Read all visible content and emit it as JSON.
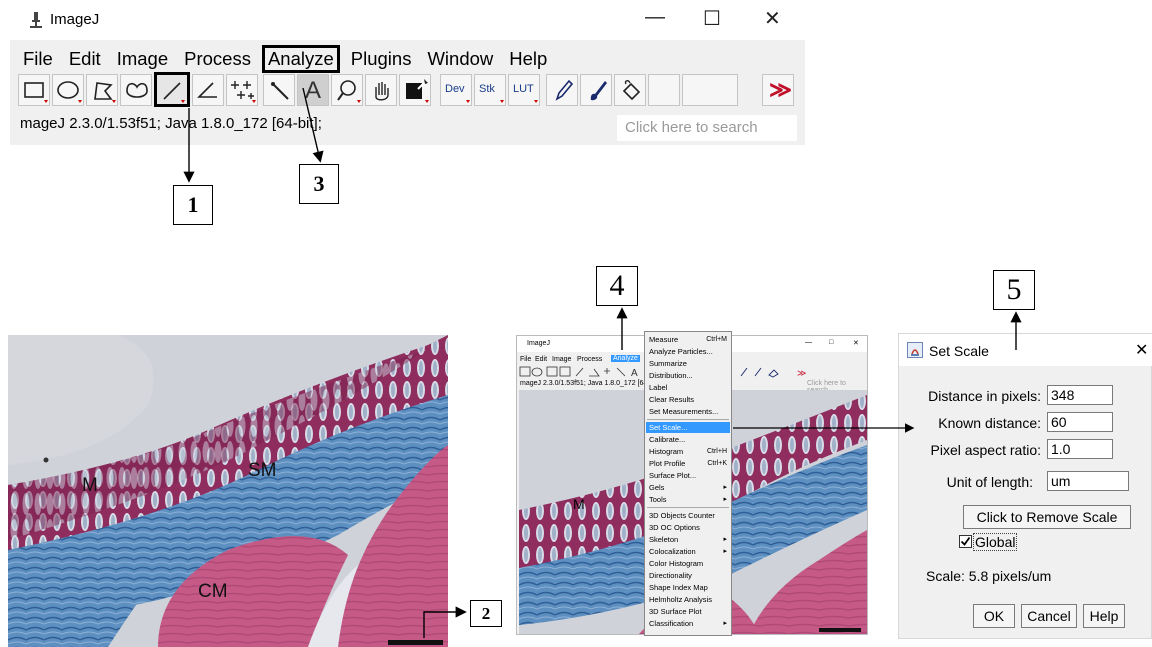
{
  "imagej_window": {
    "title": "ImageJ",
    "controls": {
      "minimize": "—",
      "maximize": "☐",
      "close": "✕"
    },
    "menus": [
      "File",
      "Edit",
      "Image",
      "Process",
      "Analyze",
      "Plugins",
      "Window",
      "Help"
    ],
    "highlighted_menu": "Analyze",
    "toolbar": {
      "dev_label": "Dev",
      "stk_label": "Stk",
      "lut_label": "LUT",
      "text_tool_glyph": "A",
      "more_glyph": "≫"
    },
    "status_text": "mageJ 2.3.0/1.53f51; Java 1.8.0_172 [64-bit];",
    "search_placeholder": "Click here to search"
  },
  "callouts": {
    "c1": "1",
    "c2": "2",
    "c3": "3",
    "c4": "4",
    "c5": "5"
  },
  "histology": {
    "labels": {
      "mucosa": "M",
      "submucosa": "SM",
      "circular_muscle": "CM"
    }
  },
  "mini_screenshot": {
    "title": "ImageJ",
    "menus": [
      "File",
      "Edit",
      "Image",
      "Process",
      "Analyze"
    ],
    "status_text": "mageJ 2.3.0/1.53f51; Java 1.8.0_172 [64-bit];",
    "search_placeholder": "Click here to search",
    "tissue_label": "M",
    "controls": {
      "minimize": "—",
      "maximize": "□",
      "close": "✕"
    }
  },
  "analyze_menu": {
    "items": [
      {
        "label": "Measure",
        "shortcut": "Ctrl+M"
      },
      {
        "label": "Analyze Particles..."
      },
      {
        "label": "Summarize"
      },
      {
        "label": "Distribution..."
      },
      {
        "label": "Label"
      },
      {
        "label": "Clear Results"
      },
      {
        "label": "Set Measurements..."
      },
      {
        "label": "Set Scale...",
        "highlighted": true
      },
      {
        "label": "Calibrate..."
      },
      {
        "label": "Histogram",
        "shortcut": "Ctrl+H"
      },
      {
        "label": "Plot Profile",
        "shortcut": "Ctrl+K"
      },
      {
        "label": "Surface Plot..."
      },
      {
        "label": "Gels",
        "submenu": true
      },
      {
        "label": "Tools",
        "submenu": true
      },
      {
        "label": "3D Objects Counter"
      },
      {
        "label": "3D OC Options"
      },
      {
        "label": "Skeleton",
        "submenu": true
      },
      {
        "label": "Colocalization",
        "submenu": true
      },
      {
        "label": "Color Histogram"
      },
      {
        "label": "Directionality"
      },
      {
        "label": "Shape Index Map"
      },
      {
        "label": "Helmholtz Analysis"
      },
      {
        "label": "3D Surface Plot"
      },
      {
        "label": "Classification",
        "submenu": true
      }
    ]
  },
  "set_scale_dialog": {
    "title": "Set Scale",
    "close": "✕",
    "distance_in_pixels_label": "Distance in pixels:",
    "distance_in_pixels_value": "348",
    "known_distance_label": "Known distance:",
    "known_distance_value": "60",
    "pixel_aspect_ratio_label": "Pixel aspect ratio:",
    "pixel_aspect_ratio_value": "1.0",
    "unit_of_length_label": "Unit of length:",
    "unit_of_length_value": "um",
    "remove_scale_button": "Click to Remove Scale",
    "global_checkbox_label": "Global",
    "global_checked": true,
    "scale_text": "Scale: 5.8 pixels/um",
    "ok_button": "OK",
    "cancel_button": "Cancel",
    "help_button": "Help"
  }
}
